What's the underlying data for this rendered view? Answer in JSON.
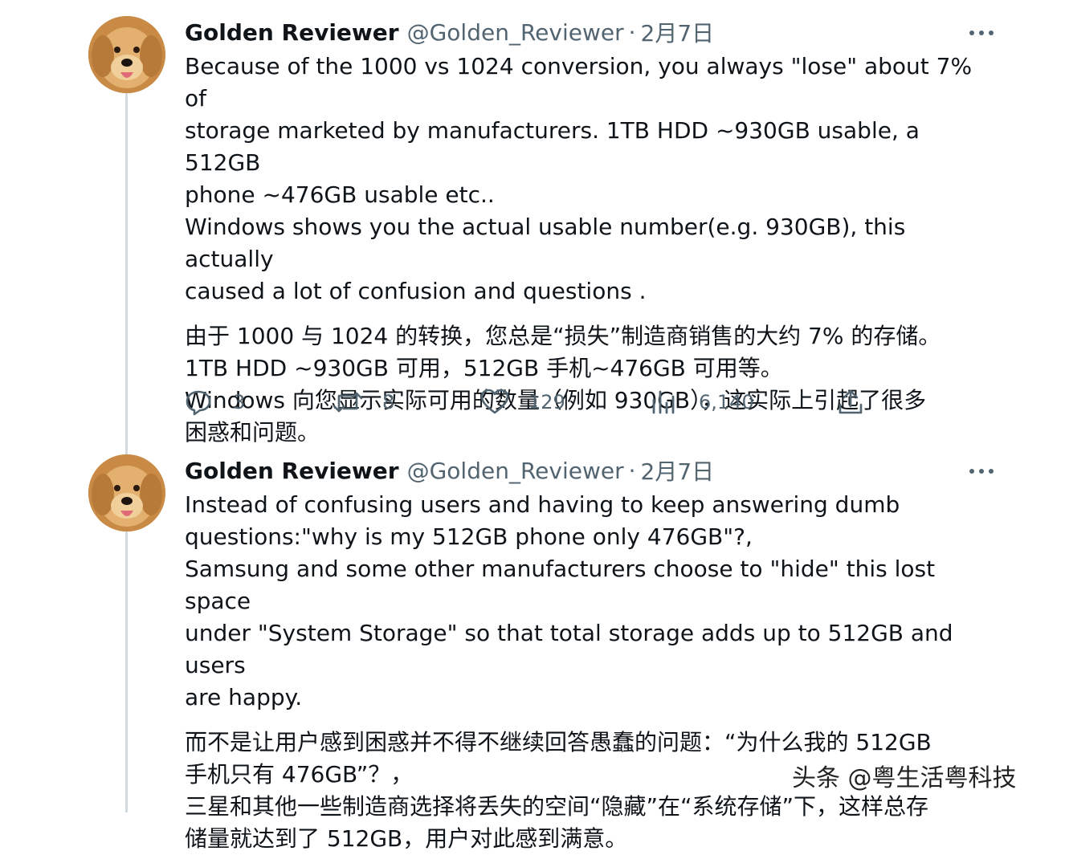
{
  "tweets": [
    {
      "author": "Golden Reviewer",
      "handle": "@Golden_Reviewer",
      "separator": "·",
      "date": "2月7日",
      "paragraphs": [
        [
          "Because of the 1000 vs 1024 conversion, you always \"lose\" about 7% of",
          "storage marketed by manufacturers. 1TB HDD ~930GB usable, a 512GB",
          "phone ~476GB usable etc..",
          "Windows shows you the actual usable number(e.g. 930GB), this actually",
          "caused a lot of confusion and questions ."
        ],
        [
          "由于 1000 与 1024 的转换，您总是“损失”制造商销售的大约 7% 的存储。",
          "1TB HDD ~930GB 可用，512GB 手机~476GB 可用等。",
          "Windows 向您显示实际可用的数量（例如 930GB），这实际上引起了很多",
          "困惑和问题。"
        ]
      ],
      "actions": {
        "replies": "3",
        "retweets": "8",
        "likes": "129",
        "views": "6,140"
      }
    },
    {
      "author": "Golden Reviewer",
      "handle": "@Golden_Reviewer",
      "separator": "·",
      "date": "2月7日",
      "paragraphs": [
        [
          "Instead of confusing users and having to keep answering dumb",
          "questions:\"why is my 512GB phone only 476GB\"?,",
          "Samsung and some other manufacturers choose to \"hide\" this lost space",
          "under \"System Storage\" so that total storage adds up to 512GB and users",
          "are happy."
        ],
        [
          "而不是让用户感到困惑并不得不继续回答愚蠢的问题：“为什么我的 512GB",
          "手机只有 476GB”？，",
          "三星和其他一些制造商选择将丢失的空间“隐藏”在“系统存储”下，这样总存",
          "储量就达到了 512GB，用户对此感到满意。"
        ]
      ]
    }
  ],
  "watermark": "头条 @粤生活粤科技",
  "colors": {
    "text": "#0f1419",
    "secondary": "#536471",
    "thread_line": "#cfd9de"
  },
  "icons": {
    "more": "more-dots-icon",
    "reply": "reply-icon",
    "retweet": "retweet-icon",
    "like": "heart-icon",
    "views": "views-chart-icon",
    "share": "share-icon"
  }
}
